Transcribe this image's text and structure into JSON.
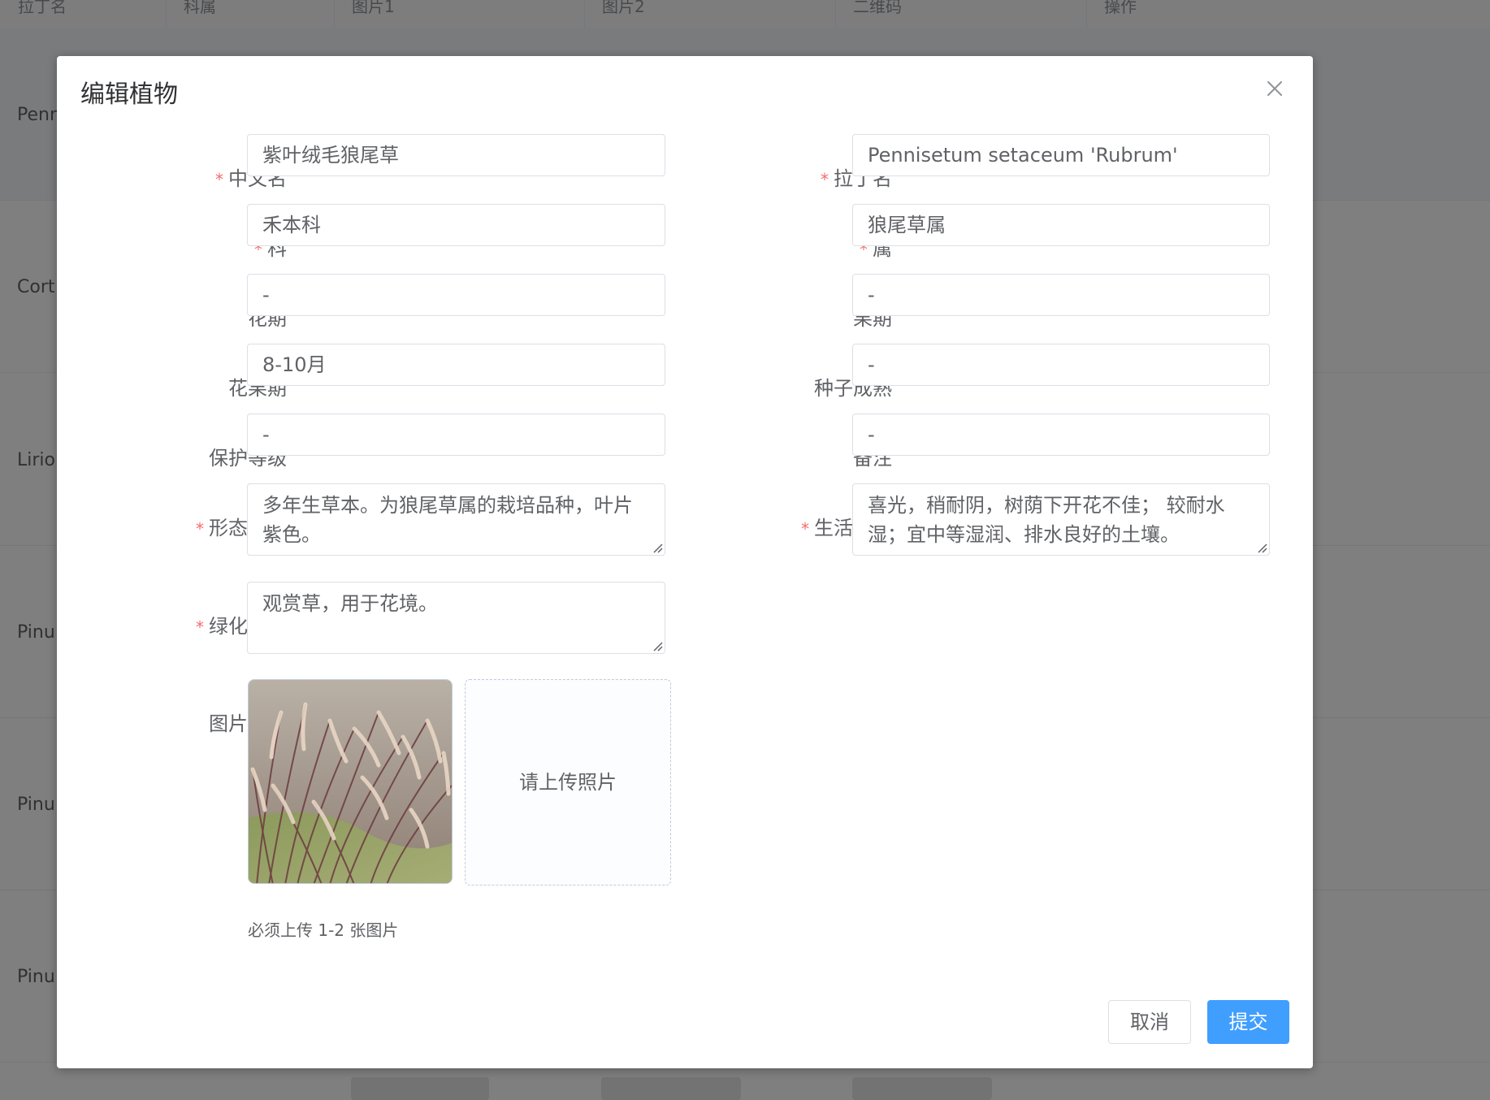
{
  "background_table": {
    "columns": [
      "拉丁名",
      "科属",
      "图片1",
      "图片2",
      "二维码",
      "操作"
    ],
    "rows": [
      "Penn",
      "Cort",
      "Lirio",
      "Pinu",
      "Pinu",
      "Pinu"
    ]
  },
  "dialog": {
    "title": "编辑植物",
    "fields": {
      "chinese_name": {
        "label": "中文名",
        "required": "*",
        "value": "紫叶绒毛狼尾草"
      },
      "latin_name": {
        "label": "拉丁名",
        "required": "*",
        "value": "Pennisetum setaceum 'Rubrum'"
      },
      "family": {
        "label": "科",
        "required": "*",
        "value": "禾本科"
      },
      "genus": {
        "label": "属",
        "required": "*",
        "value": "狼尾草属"
      },
      "flowering": {
        "label": "花期",
        "value": "-"
      },
      "fruiting": {
        "label": "果期",
        "value": "-"
      },
      "flower_fruit": {
        "label": "花果期",
        "value": "8-10月"
      },
      "seed_maturity": {
        "label": "种子成熟",
        "value": "-"
      },
      "protection": {
        "label": "保护等级",
        "value": "-"
      },
      "remarks": {
        "label": "备注",
        "value": "-"
      },
      "morphology": {
        "label": "形态特征",
        "required": "*",
        "value": "多年生草本。为狼尾草属的栽培品种，叶片紫色。"
      },
      "habit": {
        "label": "生活习性",
        "required": "*",
        "value": "喜光，稍耐阴，树荫下开花不佳； 较耐水湿；宜中等湿润、排水良好的土壤。"
      },
      "greening": {
        "label": "绿化应用",
        "required": "*",
        "value": "观赏草，用于花境。"
      },
      "images": {
        "label": "图片地址",
        "upload_text": "请上传照片",
        "hint": "必须上传 1-2 张图片"
      }
    },
    "buttons": {
      "cancel": "取消",
      "submit": "提交"
    }
  }
}
